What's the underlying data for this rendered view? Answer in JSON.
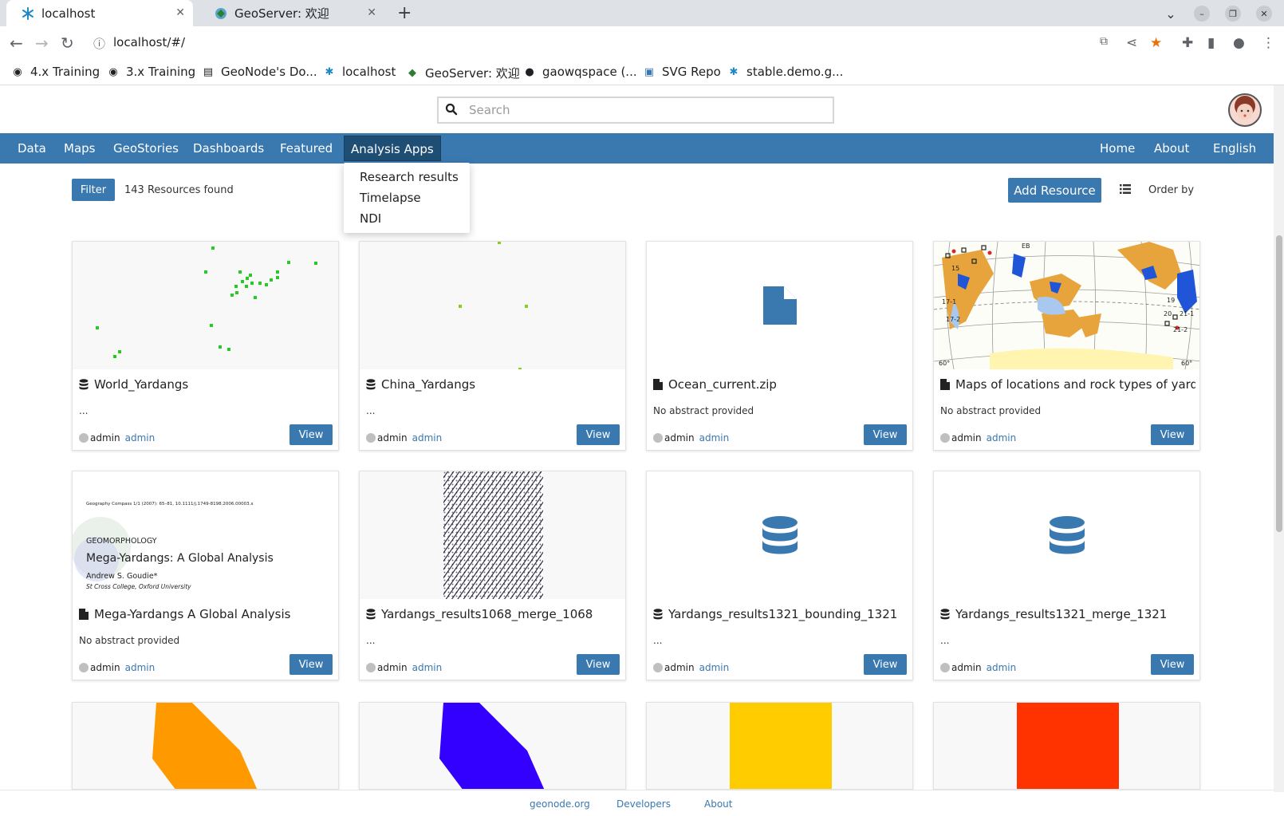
{
  "browser": {
    "tabs": [
      {
        "title": "localhost",
        "active": true
      },
      {
        "title": "GeoServer: 欢迎",
        "active": false
      }
    ],
    "url": "localhost/#/",
    "bookmarks": [
      "4.x Training",
      "3.x Training",
      "GeoNode's Do...",
      "localhost",
      "GeoServer: 欢迎",
      "gaowqspace (...",
      "SVG Repo",
      "stable.demo.g..."
    ]
  },
  "search": {
    "placeholder": "Search"
  },
  "nav": {
    "left": [
      "Data",
      "Maps",
      "GeoStories",
      "Dashboards",
      "Featured",
      "Analysis Apps"
    ],
    "right": [
      "Home",
      "About",
      "English"
    ],
    "dropdown": [
      "Research results",
      "Timelapse",
      "NDI"
    ]
  },
  "toolbar": {
    "filter": "Filter",
    "count": "143 Resources found",
    "add": "Add Resource",
    "orderby": "Order by"
  },
  "colors": {
    "brand": "#3a78b0",
    "active_nav": "#1f4e75"
  },
  "cards": [
    {
      "title": "World_Yardangs",
      "abstract": "...",
      "owner_alt": "admin",
      "owner": "admin",
      "view": "View",
      "type_icon": "database-icon"
    },
    {
      "title": "China_Yardangs",
      "abstract": "...",
      "owner_alt": "admin",
      "owner": "admin",
      "view": "View",
      "type_icon": "database-icon"
    },
    {
      "title": "Ocean_current.zip",
      "abstract": "No abstract provided",
      "owner_alt": "admin",
      "owner": "admin",
      "view": "View",
      "type_icon": "file-icon"
    },
    {
      "title": "Maps of locations and rock types of yarda...",
      "abstract": "No abstract provided",
      "owner_alt": "admin",
      "owner": "admin",
      "view": "View",
      "type_icon": "file-icon"
    },
    {
      "title": "Mega-Yardangs A Global Analysis",
      "abstract": "No abstract provided",
      "owner_alt": "admin",
      "owner": "admin",
      "view": "View",
      "type_icon": "file-icon"
    },
    {
      "title": "Yardangs_results1068_merge_1068",
      "abstract": "...",
      "owner_alt": "admin",
      "owner": "admin",
      "view": "View",
      "type_icon": "database-icon"
    },
    {
      "title": "Yardangs_results1321_bounding_1321",
      "abstract": "...",
      "owner_alt": "admin",
      "owner": "admin",
      "view": "View",
      "type_icon": "database-icon"
    },
    {
      "title": "Yardangs_results1321_merge_1321",
      "abstract": "...",
      "owner_alt": "admin",
      "owner": "admin",
      "view": "View",
      "type_icon": "database-icon"
    }
  ],
  "paper_thumb": {
    "citation": "Geography Compass 1/1 (2007): 65–81, 10.1111/j.1749-8198.2006.00003.x",
    "section": "GEOMORPHOLOGY",
    "title": "Mega-Yardangs: A Global Analysis",
    "author": "Andrew S. Goudie*",
    "affiliation": "St Cross College, Oxford University"
  },
  "map_thumb_labels": [
    "15",
    "17-1",
    "17-2",
    "19",
    "20",
    "21-1",
    "21-2",
    "EB",
    "60°",
    "60°"
  ],
  "third_row_colors": [
    "#ff9900",
    "#3300ff",
    "#ffcc00",
    "#ff3300"
  ],
  "footer": [
    "geonode.org",
    "Developers",
    "About"
  ]
}
